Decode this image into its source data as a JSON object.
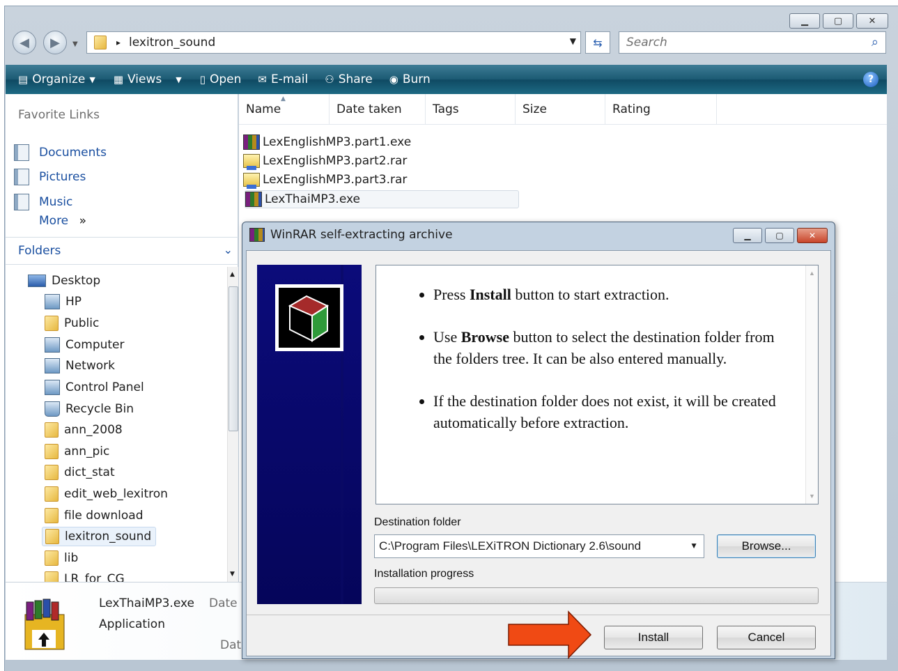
{
  "window": {
    "caption_buttons": [
      "minimize",
      "maximize",
      "close"
    ]
  },
  "address": {
    "path_separator": "▸",
    "folder": "lexitron_sound"
  },
  "search": {
    "placeholder": "Search"
  },
  "toolbar": {
    "organize": "Organize",
    "views": "Views",
    "open": "Open",
    "email": "E-mail",
    "share": "Share",
    "burn": "Burn",
    "help": "?"
  },
  "navpane": {
    "favorites_heading": "Favorite Links",
    "favorites": [
      "Documents",
      "Pictures",
      "Music"
    ],
    "more": "More",
    "more_glyph": "»",
    "folders_heading": "Folders",
    "tree": [
      "Desktop",
      "HP",
      "Public",
      "Computer",
      "Network",
      "Control Panel",
      "Recycle Bin",
      "ann_2008",
      "ann_pic",
      "dict_stat",
      "edit_web_lexitron",
      "file download",
      "lexitron_sound",
      "lib",
      "LR_for_CG"
    ],
    "selected": "lexitron_sound"
  },
  "filelist": {
    "columns": [
      "Name",
      "Date taken",
      "Tags",
      "Size",
      "Rating"
    ],
    "files": [
      "LexEnglishMP3.part1.exe",
      "LexEnglishMP3.part2.rar",
      "LexEnglishMP3.part3.rar",
      "LexThaiMP3.exe"
    ],
    "selected": "LexThaiMP3.exe"
  },
  "details": {
    "filename": "LexThaiMP3.exe",
    "type": "Application",
    "date_label_1": "Date",
    "date_label_2": "Dat"
  },
  "dialog": {
    "title": "WinRAR self-extracting archive",
    "bullets": [
      {
        "pre": "Press ",
        "bold": "Install",
        "post": " button to start extraction."
      },
      {
        "pre": "Use ",
        "bold": "Browse",
        "post": " button to select the destination folder from the folders tree. It can be also entered manually."
      },
      {
        "pre": "",
        "bold": "",
        "post": "If the destination folder does not exist, it will be created automatically before extraction."
      }
    ],
    "destination_label": "Destination folder",
    "destination_value": "C:\\Program Files\\LEXiTRON Dictionary 2.6\\sound",
    "browse_label": "Browse...",
    "progress_label": "Installation progress",
    "progress_fraction": 0,
    "install_label": "Install",
    "cancel_label": "Cancel"
  },
  "colors": {
    "toolbar": "#1b5a73",
    "link": "#1a4fa0",
    "banner": "#0b0b7a",
    "arrow": "#f04a14",
    "close_button": "#c8452a"
  }
}
